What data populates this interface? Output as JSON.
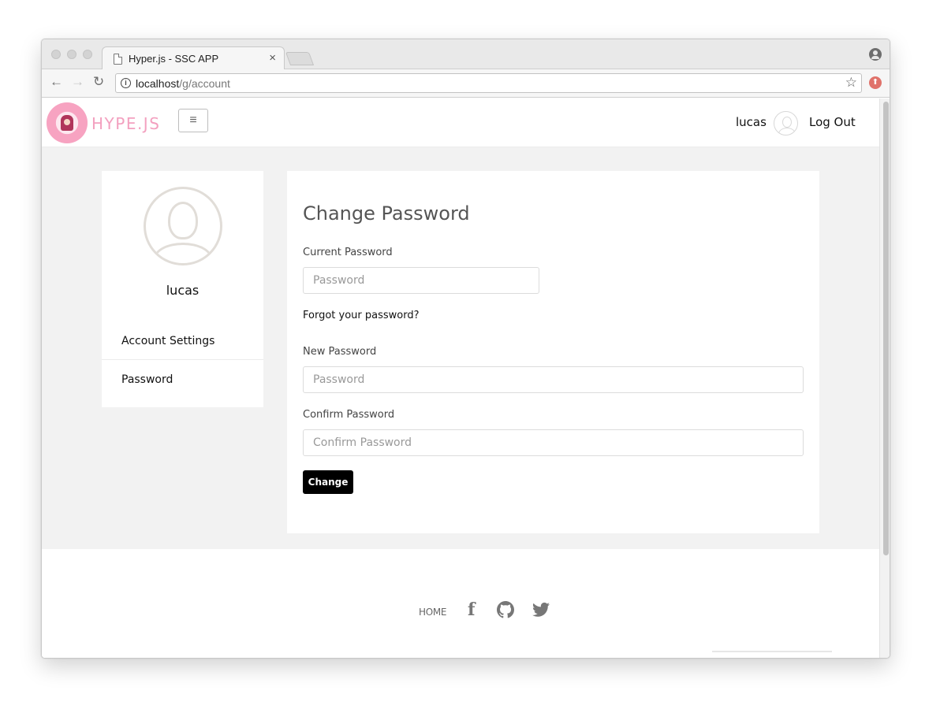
{
  "browser": {
    "tab_title": "Hyper.js - SSC APP",
    "tab_close": "×",
    "url_host": "localhost",
    "url_path": "/g/account",
    "back_glyph": "←",
    "forward_glyph": "→",
    "reload_glyph": "↻",
    "star_glyph": "☆",
    "info_glyph": "i",
    "extension_glyph": "⬆"
  },
  "header": {
    "brand": "HYPE.JS",
    "menu_glyph": "≡",
    "username": "lucas",
    "logout_label": "Log Out"
  },
  "sidebar": {
    "name": "lucas",
    "items": [
      {
        "label": "Account Settings"
      },
      {
        "label": "Password"
      }
    ]
  },
  "form": {
    "title": "Change Password",
    "current_label": "Current Password",
    "current_placeholder": "Password",
    "forgot_link": "Forgot your password?",
    "new_label": "New Password",
    "new_placeholder": "Password",
    "confirm_label": "Confirm Password",
    "confirm_placeholder": "Confirm Password",
    "submit_label": "Change"
  },
  "footer": {
    "home_link": "HOME",
    "facebook_glyph": "f"
  },
  "colors": {
    "brand_pink": "#f3a0bf",
    "button_bg": "#000000",
    "content_bg": "#f2f2f2"
  }
}
